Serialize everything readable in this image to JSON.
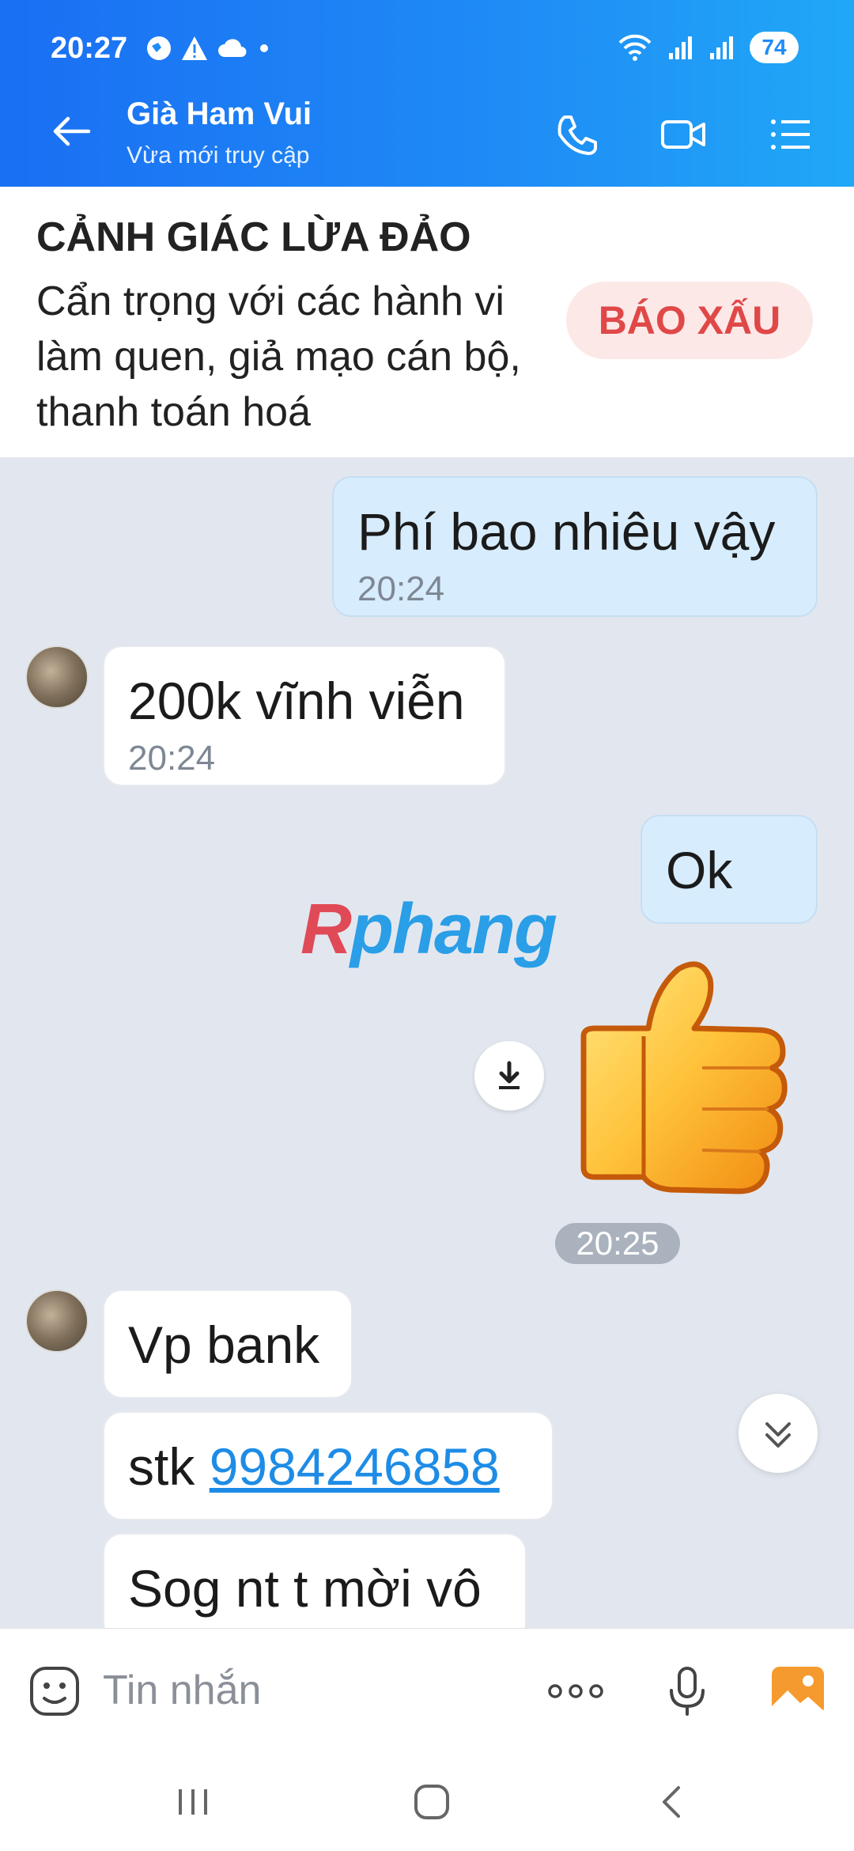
{
  "status_bar": {
    "time": "20:27",
    "battery": "74"
  },
  "header": {
    "title": "Già Ham Vui",
    "subtitle": "Vừa mới truy cập"
  },
  "warning": {
    "title": "CẢNH GIÁC LỪA ĐẢO",
    "description": "Cẩn trọng với các hành vi làm quen, giả mạo cán bộ, thanh toán hoá",
    "report_label": "BÁO XẤU"
  },
  "messages": [
    {
      "text": "Phí bao nhiêu vậy",
      "time": "20:24"
    },
    {
      "text": "200k vĩnh viễn",
      "time": "20:24"
    },
    {
      "text": "Ok"
    },
    {
      "text": "Vp bank"
    },
    {
      "text_prefix": "stk ",
      "link": "9984246858"
    },
    {
      "text": "Sog nt t mời vô"
    }
  ],
  "sticker_time": "20:25",
  "watermark": {
    "r": "R",
    "rest": "phang"
  },
  "composer": {
    "placeholder": "Tin nhắn"
  },
  "colors": {
    "header": "#1f8cf6",
    "report_text": "#e04848",
    "outgoing_bubble": "#d7ecfd",
    "link": "#1d8ce6"
  },
  "icons": [
    "back-arrow-icon",
    "phone-icon",
    "video-call-icon",
    "menu-list-icon",
    "download-icon",
    "chevron-double-down-icon",
    "emoji-icon",
    "more-icon",
    "microphone-icon",
    "gallery-icon",
    "thumbs-up-sticker"
  ]
}
